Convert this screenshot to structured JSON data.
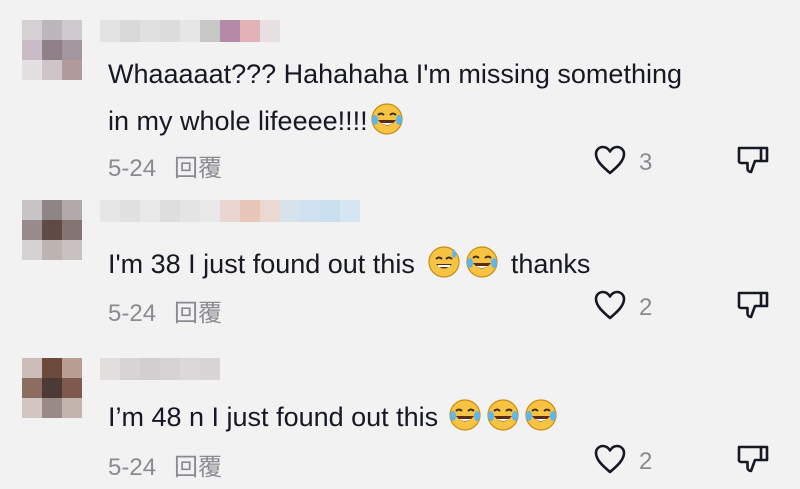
{
  "comments": [
    {
      "text_before": "Whaaaaat??? Hahahaha I'm missing something in my whole lifeeee!!!!",
      "text_after": "",
      "emojis": [
        "laughing-tears-emoji"
      ],
      "date": "5-24",
      "reply_label": "回覆",
      "likes": "3"
    },
    {
      "text_before": "I'm 38 I just found out this",
      "text_after": "thanks",
      "emojis": [
        "sweat-smile-emoji",
        "laughing-tears-emoji"
      ],
      "date": "5-24",
      "reply_label": "回覆",
      "likes": "2"
    },
    {
      "text_before": "I’m 48 n I just found out this",
      "text_after": "",
      "emojis": [
        "laughing-tears-emoji",
        "laughing-tears-emoji",
        "laughing-tears-emoji"
      ],
      "date": "5-24",
      "reply_label": "回覆",
      "likes": "2"
    }
  ],
  "icons": {
    "like": "heart-outline-icon",
    "dislike": "thumbs-down-outline-icon"
  },
  "colors": {
    "background": "#f2f2f2",
    "text": "#161823",
    "meta": "#8a8b91"
  }
}
